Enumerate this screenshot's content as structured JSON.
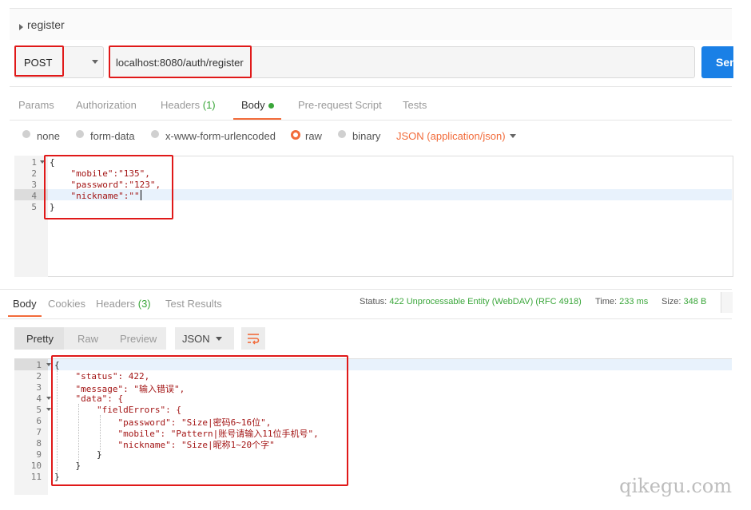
{
  "request": {
    "name": "register",
    "method": "POST",
    "url": "localhost:8080/auth/register",
    "send_label": "Send"
  },
  "request_tabs": [
    {
      "label": "Params",
      "count": ""
    },
    {
      "label": "Authorization",
      "count": ""
    },
    {
      "label": "Headers ",
      "count": "(1)"
    },
    {
      "label": "Body",
      "count": ""
    },
    {
      "label": "Pre-request Script",
      "count": ""
    },
    {
      "label": "Tests",
      "count": ""
    }
  ],
  "body_modes": [
    {
      "label": "none",
      "selected": false
    },
    {
      "label": "form-data",
      "selected": false
    },
    {
      "label": "x-www-form-urlencoded",
      "selected": false
    },
    {
      "label": "raw",
      "selected": true
    },
    {
      "label": "binary",
      "selected": false
    }
  ],
  "content_type": "JSON (application/json)",
  "request_body": {
    "line_numbers": [
      "1",
      "2",
      "3",
      "4",
      "5"
    ],
    "lines": [
      "{",
      "    \"mobile\":\"135\",",
      "    \"password\":\"123\",",
      "    \"nickname\":\"\"",
      "}"
    ]
  },
  "response_tabs": [
    {
      "label": "Body",
      "count": ""
    },
    {
      "label": "Cookies",
      "count": ""
    },
    {
      "label": "Headers ",
      "count": "(3)"
    },
    {
      "label": "Test Results",
      "count": ""
    }
  ],
  "status": {
    "status_label": "Status:",
    "status_value": "422 Unprocessable Entity (WebDAV) (RFC 4918)",
    "time_label": "Time:",
    "time_value": "233 ms",
    "size_label": "Size:",
    "size_value": "348 B"
  },
  "response_toolbar": {
    "pretty": "Pretty",
    "raw": "Raw",
    "preview": "Preview",
    "format": "JSON"
  },
  "response_body": {
    "line_numbers": [
      "1",
      "2",
      "3",
      "4",
      "5",
      "6",
      "7",
      "8",
      "9",
      "10",
      "11"
    ],
    "lines": [
      "{",
      "    \"status\": 422,",
      "    \"message\": \"输入错误\",",
      "    \"data\": {",
      "        \"fieldErrors\": {",
      "            \"password\": \"Size|密码6~16位\",",
      "            \"mobile\": \"Pattern|账号请输入11位手机号\",",
      "            \"nickname\": \"Size|昵称1~20个字\"",
      "        }",
      "    }",
      "}"
    ]
  },
  "watermark": "qikegu.com",
  "colors": {
    "accent": "#f26b3a",
    "send": "#1a80e6",
    "success": "#3aa63a",
    "highlight_box": "#e01919"
  }
}
